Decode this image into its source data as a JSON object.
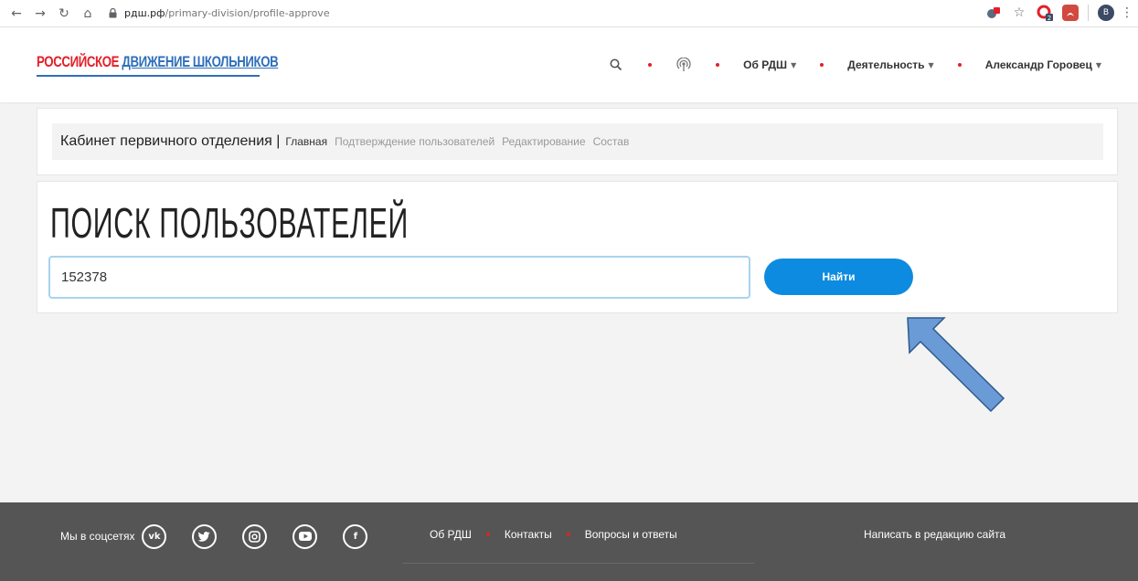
{
  "browser": {
    "url_host": "рдш.рф",
    "url_path": "/primary-division/profile-approve",
    "profile_initial": "B",
    "ext_badge": "2"
  },
  "header": {
    "logo_part1": "РОССИЙСКОЕ",
    "logo_part2": "ДВИЖЕНИЕ ШКОЛЬНИКОВ",
    "nav_about": "Об РДШ",
    "nav_activity": "Деятельность",
    "nav_user": "Александр Горовец"
  },
  "cabinet": {
    "title": "Кабинет первичного отделения |",
    "tabs": [
      {
        "label": "Главная",
        "active": true
      },
      {
        "label": "Подтверждение пользователей",
        "active": false
      },
      {
        "label": "Редактирование",
        "active": false
      },
      {
        "label": "Состав",
        "active": false
      }
    ]
  },
  "search": {
    "title": "ПОИСК ПОЛЬЗОВАТЕЛЕЙ",
    "input_value": "152378",
    "button_label": "Найти"
  },
  "footer": {
    "social_label": "Мы в соцсетях",
    "social_icons": [
      "vk-icon",
      "twitter-icon",
      "instagram-icon",
      "youtube-icon",
      "facebook-icon"
    ],
    "vk_text": "vk",
    "fb_text": "f",
    "nav": [
      "Об РДШ",
      "Контакты",
      "Вопросы и ответы"
    ],
    "write_label": "Написать в редакцию сайта"
  },
  "colors": {
    "brand_red": "#e3202a",
    "brand_blue": "#2f6fb9",
    "button_blue": "#0d8be0",
    "footer_bg": "#555555",
    "arrow_fill": "#6b9bd6"
  }
}
